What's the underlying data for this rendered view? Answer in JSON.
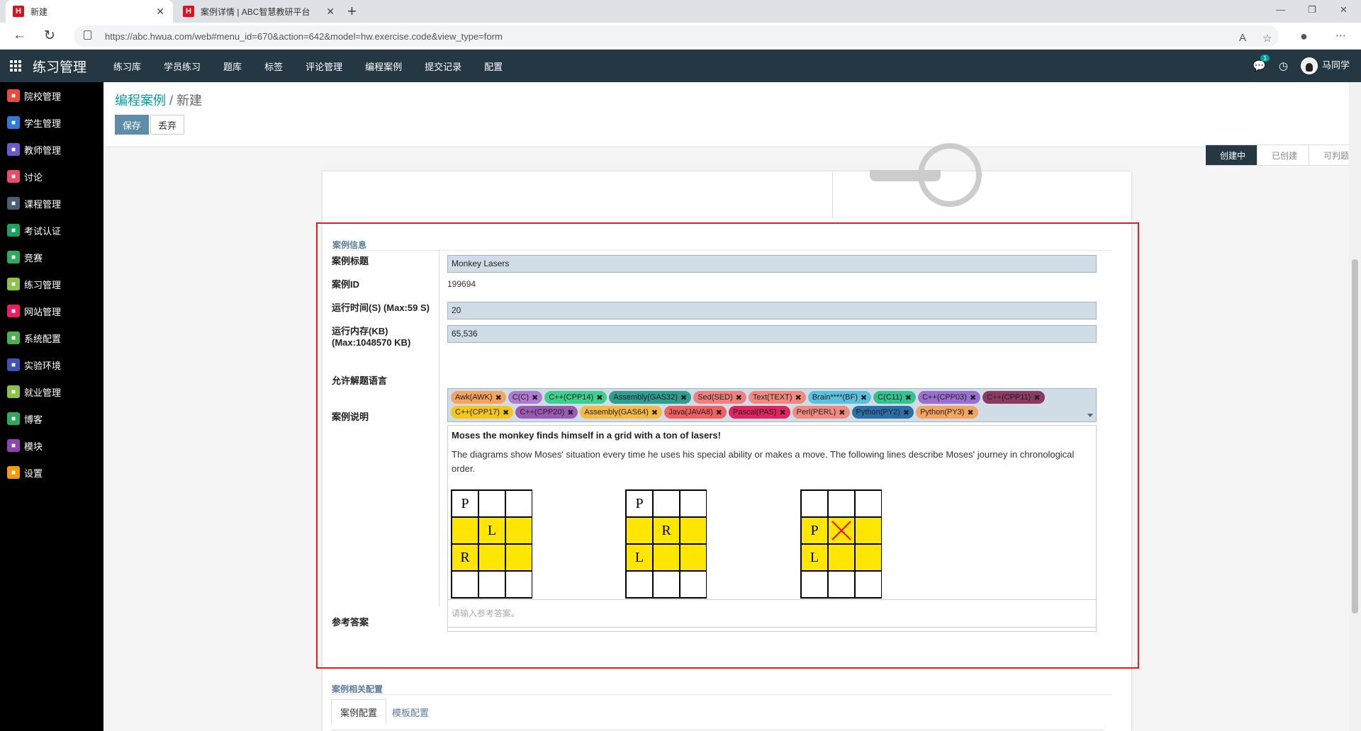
{
  "browser": {
    "tabs": [
      {
        "favicon": "H",
        "title": "新建"
      },
      {
        "favicon": "H",
        "title": "案例详情 | ABC智慧教研平台"
      }
    ],
    "url": "https://abc.hwua.com/web#menu_id=670&action=642&model=hw.exercise.code&view_type=form"
  },
  "appnav": {
    "app_name": "练习管理",
    "menus": [
      "练习库",
      "学员练习",
      "题库",
      "标签",
      "评论管理",
      "编程案例",
      "提交记录",
      "配置"
    ],
    "chat_badge": "1",
    "user": "马同学"
  },
  "sidebar": {
    "items": [
      {
        "label": "院校管理",
        "color": "#e84c3d",
        "icon": "school-icon"
      },
      {
        "label": "学生管理",
        "color": "#2b7bd9",
        "icon": "student-icon"
      },
      {
        "label": "教师管理",
        "color": "#6a5acd",
        "icon": "teacher-icon"
      },
      {
        "label": "讨论",
        "color": "#e84c6d",
        "icon": "discuss-icon"
      },
      {
        "label": "课程管理",
        "color": "#4a5f73",
        "icon": "course-icon"
      },
      {
        "label": "考试认证",
        "color": "#20a060",
        "icon": "exam-icon"
      },
      {
        "label": "竞赛",
        "color": "#2eaa5a",
        "icon": "cloud-icon"
      },
      {
        "label": "练习管理",
        "color": "#8bc34a",
        "icon": "practice-icon"
      },
      {
        "label": "网站管理",
        "color": "#e91e63",
        "icon": "website-icon"
      },
      {
        "label": "系统配置",
        "color": "#4caf50",
        "icon": "wrench-icon"
      },
      {
        "label": "实验环境",
        "color": "#3f51b5",
        "icon": "lab-icon"
      },
      {
        "label": "就业管理",
        "color": "#8bc34a",
        "icon": "job-icon"
      },
      {
        "label": "博客",
        "color": "#2eaa5a",
        "icon": "cloud-icon"
      },
      {
        "label": "模块",
        "color": "#8e44ad",
        "icon": "module-icon"
      },
      {
        "label": "设置",
        "color": "#f39c12",
        "icon": "gear-icon"
      }
    ]
  },
  "control": {
    "breadcrumb_parent": "编程案例",
    "breadcrumb_sep": " / ",
    "breadcrumb_current": "新建",
    "save": "保存",
    "discard": "丢弃",
    "stages": [
      "创建中",
      "已创建",
      "可判题"
    ]
  },
  "form": {
    "section_title": "案例信息",
    "fields": {
      "title_label": "案例标题",
      "title_value": "Monkey Lasers",
      "id_label": "案例ID",
      "id_value": "199694",
      "time_label": "运行时间(S) (Max:59 S)",
      "time_value": "20",
      "mem_label": "运行内存(KB)",
      "mem_label2": "(Max:1048570 KB)",
      "mem_value": "65,536",
      "lang_label": "允许解题语言",
      "desc_label": "案例说明",
      "answer_label": "参考答案",
      "answer_placeholder": "请输入参考答案。"
    },
    "languages_row1": [
      {
        "name": "Awk(AWK)",
        "color": "#f4a460"
      },
      {
        "name": "C(C)",
        "color": "#b07cd0"
      },
      {
        "name": "C++(CPP14)",
        "color": "#3ecf8e"
      },
      {
        "name": "Assembly(GAS32)",
        "color": "#2f9e8f"
      },
      {
        "name": "Sed(SED)",
        "color": "#f08080"
      },
      {
        "name": "Text(TEXT)",
        "color": "#f08a7e"
      },
      {
        "name": "Brain****(BF)",
        "color": "#5bc0de"
      },
      {
        "name": "C(C11)",
        "color": "#34c38f"
      },
      {
        "name": "C++(CPP03)",
        "color": "#9b6fd1"
      },
      {
        "name": "C++(CPP11)",
        "color": "#8b3a62"
      }
    ],
    "languages_row2": [
      {
        "name": "C++(CPP17)",
        "color": "#f5c518"
      },
      {
        "name": "C++(CPP20)",
        "color": "#9b59b6"
      },
      {
        "name": "Assembly(GAS64)",
        "color": "#f4b942"
      },
      {
        "name": "Java(JAVA8)",
        "color": "#f06060"
      },
      {
        "name": "Pascal(PAS)",
        "color": "#e0245e"
      },
      {
        "name": "Perl(PERL)",
        "color": "#f08a7e"
      },
      {
        "name": "Python(PY2)",
        "color": "#2a6fa8"
      },
      {
        "name": "Python(PY3)",
        "color": "#f4a460"
      }
    ],
    "description": {
      "lead": "Moses the monkey finds himself in a grid with a ton of lasers!",
      "para": "The diagrams show Moses' situation every time he uses his special ability or makes a move. The following lines describe Moses' journey in chronological order."
    },
    "diagrams": [
      {
        "cells": [
          [
            "P",
            "",
            ""
          ],
          [
            "",
            "L",
            ""
          ],
          [
            "R",
            "",
            ""
          ],
          [
            "",
            "",
            ""
          ]
        ],
        "yellow": [
          [
            0,
            0,
            0
          ],
          [
            1,
            1,
            1
          ],
          [
            1,
            1,
            1
          ],
          [
            0,
            0,
            0
          ]
        ],
        "cross": [
          [
            0,
            0,
            0
          ],
          [
            0,
            0,
            0
          ],
          [
            0,
            0,
            0
          ],
          [
            0,
            0,
            0
          ]
        ]
      },
      {
        "cells": [
          [
            "P",
            "",
            ""
          ],
          [
            "",
            "R",
            ""
          ],
          [
            "L",
            "",
            ""
          ],
          [
            "",
            "",
            ""
          ]
        ],
        "yellow": [
          [
            0,
            0,
            0
          ],
          [
            1,
            1,
            1
          ],
          [
            1,
            1,
            1
          ],
          [
            0,
            0,
            0
          ]
        ],
        "cross": [
          [
            0,
            0,
            0
          ],
          [
            0,
            0,
            0
          ],
          [
            0,
            0,
            0
          ],
          [
            0,
            0,
            0
          ]
        ]
      },
      {
        "cells": [
          [
            "",
            "",
            ""
          ],
          [
            "P",
            "",
            ""
          ],
          [
            "L",
            "",
            ""
          ],
          [
            "",
            "",
            ""
          ]
        ],
        "yellow": [
          [
            0,
            0,
            0
          ],
          [
            1,
            1,
            1
          ],
          [
            1,
            1,
            1
          ],
          [
            0,
            0,
            0
          ]
        ],
        "cross": [
          [
            0,
            0,
            0
          ],
          [
            0,
            1,
            0
          ],
          [
            0,
            0,
            0
          ],
          [
            0,
            0,
            0
          ]
        ]
      }
    ],
    "related_section": "案例相关配置",
    "subtabs": [
      "案例配置",
      "模板配置"
    ]
  }
}
